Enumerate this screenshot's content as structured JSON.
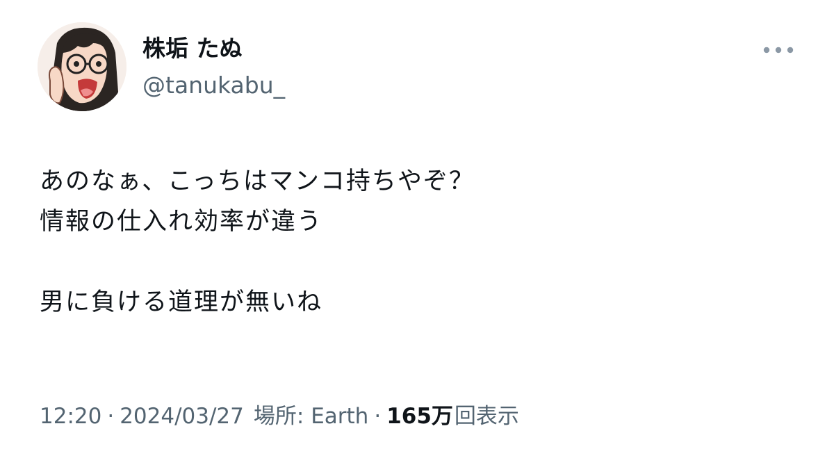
{
  "author": {
    "display_name": "株垢 たぬ",
    "username": "@tanukabu_",
    "avatar_icon": "cartoon-avatar-icon"
  },
  "more_icon": "more-dots-icon",
  "tweet": {
    "lines": [
      "あのなぁ、こっちはマンコ持ちやぞ？",
      "情報の仕入れ効率が違う",
      "",
      "男に負ける道理が無いね"
    ]
  },
  "meta": {
    "time": "12:20",
    "separator": "·",
    "date": "2024/03/27",
    "location": "場所: Earth",
    "views_count": "165万",
    "views_label": "回表示"
  },
  "colors": {
    "text_primary": "#0f1419",
    "text_secondary": "#536471",
    "background": "#ffffff"
  }
}
